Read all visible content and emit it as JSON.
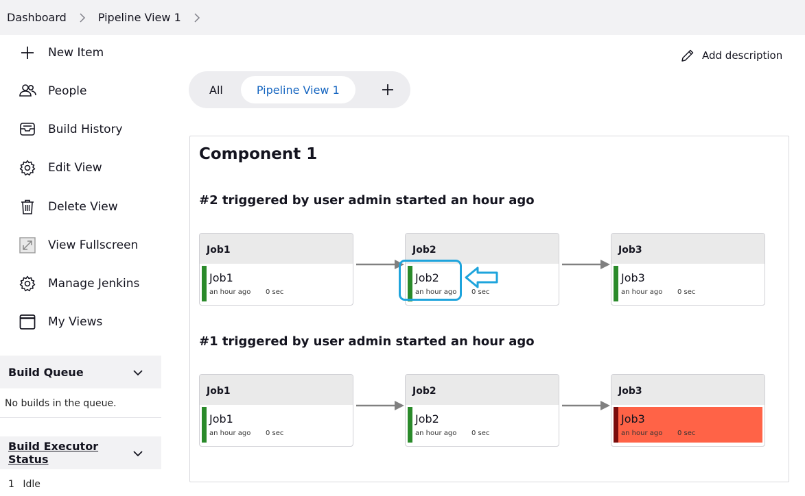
{
  "breadcrumb": {
    "items": [
      "Dashboard",
      "Pipeline View 1"
    ]
  },
  "sidebar": {
    "items": [
      {
        "label": "New Item",
        "icon": "plus-icon"
      },
      {
        "label": "People",
        "icon": "people-icon"
      },
      {
        "label": "Build History",
        "icon": "build-history-icon"
      },
      {
        "label": "Edit View",
        "icon": "gear-icon"
      },
      {
        "label": "Delete View",
        "icon": "trash-icon"
      },
      {
        "label": "View Fullscreen",
        "icon": "fullscreen-icon"
      },
      {
        "label": "Manage Jenkins",
        "icon": "gear-icon"
      },
      {
        "label": "My Views",
        "icon": "window-icon"
      }
    ]
  },
  "build_queue": {
    "title": "Build Queue",
    "empty_text": "No builds in the queue."
  },
  "executor_status": {
    "title": "Build Executor Status",
    "executor_number": "1",
    "executor_state": "Idle"
  },
  "header": {
    "add_description": "Add description"
  },
  "tabs": {
    "items": [
      "All",
      "Pipeline View 1"
    ],
    "active": "Pipeline View 1"
  },
  "pipeline": {
    "component_title": "Component 1",
    "runs": [
      {
        "title": "#2 triggered by user admin started an hour ago",
        "jobs": [
          {
            "header": "Job1",
            "name": "Job1",
            "time": "an hour ago",
            "duration": "0 sec",
            "status": "success"
          },
          {
            "header": "Job2",
            "name": "Job2",
            "time": "an hour ago",
            "duration": "0 sec",
            "status": "success"
          },
          {
            "header": "Job3",
            "name": "Job3",
            "time": "an hour ago",
            "duration": "0 sec",
            "status": "success"
          }
        ]
      },
      {
        "title": "#1 triggered by user admin started an hour ago",
        "jobs": [
          {
            "header": "Job1",
            "name": "Job1",
            "time": "an hour ago",
            "duration": "0 sec",
            "status": "success"
          },
          {
            "header": "Job2",
            "name": "Job2",
            "time": "an hour ago",
            "duration": "0 sec",
            "status": "success"
          },
          {
            "header": "Job3",
            "name": "Job3",
            "time": "an hour ago",
            "duration": "0 sec",
            "status": "failed"
          }
        ]
      }
    ]
  },
  "colors": {
    "accent": "#1565c0",
    "success": "#2a8a2a",
    "failed_bg": "#ff6347",
    "failed_bar": "#7a0c0c",
    "highlight": "#1ea4dc"
  }
}
